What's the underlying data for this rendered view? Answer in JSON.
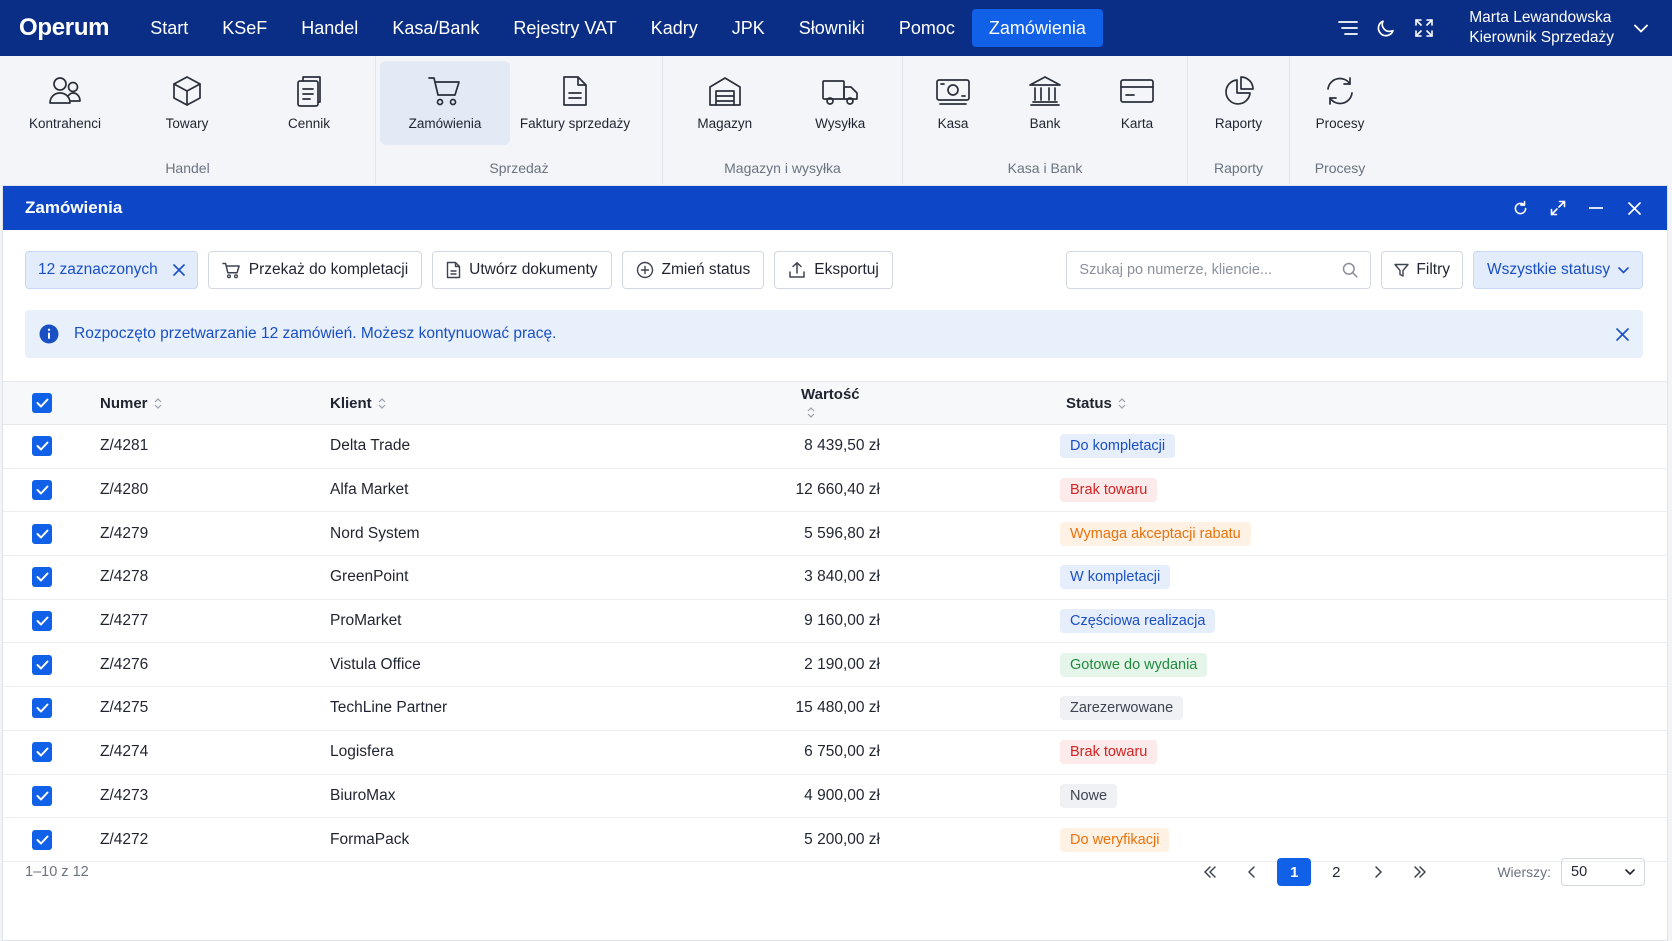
{
  "app": {
    "logo": "Operum"
  },
  "menu": [
    {
      "label": "Start"
    },
    {
      "label": "KSeF"
    },
    {
      "label": "Handel"
    },
    {
      "label": "Kasa/Bank"
    },
    {
      "label": "Rejestry VAT"
    },
    {
      "label": "Kadry"
    },
    {
      "label": "JPK"
    },
    {
      "label": "Słowniki"
    },
    {
      "label": "Pomoc"
    },
    {
      "label": "Zamówienia",
      "active": true
    }
  ],
  "user": {
    "name": "Marta Lewandowska",
    "role": "Kierownik Sprzedaży"
  },
  "ribbon": {
    "groups": [
      {
        "label": "Handel",
        "items": [
          {
            "label": "Kontrahenci",
            "icon": "users-icon"
          },
          {
            "label": "Towary",
            "icon": "box-icon"
          },
          {
            "label": "Cennik",
            "icon": "price-list-icon"
          }
        ]
      },
      {
        "label": "Sprzedaż",
        "items": [
          {
            "label": "Zamówienia",
            "icon": "cart-icon",
            "active": true
          },
          {
            "label": "Faktury sprzedaży",
            "icon": "document-icon"
          }
        ]
      },
      {
        "label": "Magazyn i wysyłka",
        "items": [
          {
            "label": "Magazyn",
            "icon": "warehouse-icon"
          },
          {
            "label": "Wysyłka",
            "icon": "truck-icon"
          }
        ]
      },
      {
        "label": "Kasa i Bank",
        "items": [
          {
            "label": "Kasa",
            "icon": "cash-icon"
          },
          {
            "label": "Bank",
            "icon": "bank-icon"
          },
          {
            "label": "Karta",
            "icon": "card-icon"
          }
        ]
      },
      {
        "label": "Raporty",
        "items": [
          {
            "label": "Raporty",
            "icon": "pie-chart-icon"
          }
        ]
      },
      {
        "label": "Procesy",
        "items": [
          {
            "label": "Procesy",
            "icon": "refresh-icon"
          }
        ]
      }
    ]
  },
  "window": {
    "title": "Zamówienia"
  },
  "toolbar": {
    "selected": "12 zaznaczonych",
    "handover": "Przekaż do kompletacji",
    "create_docs": "Utwórz dokumenty",
    "change_status": "Zmień status",
    "export": "Eksportuj",
    "search_placeholder": "Szukaj po numerze, kliencie...",
    "filters": "Filtry",
    "status_filter": "Wszystkie statusy"
  },
  "info": {
    "message": "Rozpoczęto przetwarzanie 12 zamówień. Możesz kontynuować pracę."
  },
  "table": {
    "headers": {
      "number": "Numer",
      "client": "Klient",
      "value": "Wartość",
      "status": "Status"
    },
    "rows": [
      {
        "number": "Z/4281",
        "client": "Delta Trade",
        "value": "8 439,50 zł",
        "status": "Do kompletacji",
        "tone": "blue"
      },
      {
        "number": "Z/4280",
        "client": "Alfa Market",
        "value": "12 660,40 zł",
        "status": "Brak towaru",
        "tone": "red"
      },
      {
        "number": "Z/4279",
        "client": "Nord System",
        "value": "5 596,80 zł",
        "status": "Wymaga akceptacji rabatu",
        "tone": "orange"
      },
      {
        "number": "Z/4278",
        "client": "GreenPoint",
        "value": "3 840,00 zł",
        "status": "W kompletacji",
        "tone": "blue"
      },
      {
        "number": "Z/4277",
        "client": "ProMarket",
        "value": "9 160,00 zł",
        "status": "Częściowa realizacja",
        "tone": "blue"
      },
      {
        "number": "Z/4276",
        "client": "Vistula Office",
        "value": "2 190,00 zł",
        "status": "Gotowe do wydania",
        "tone": "green"
      },
      {
        "number": "Z/4275",
        "client": "TechLine Partner",
        "value": "15 480,00 zł",
        "status": "Zarezerwowane",
        "tone": "gray"
      },
      {
        "number": "Z/4274",
        "client": "Logisfera",
        "value": "6 750,00 zł",
        "status": "Brak towaru",
        "tone": "red"
      },
      {
        "number": "Z/4273",
        "client": "BiuroMax",
        "value": "4 900,00 zł",
        "status": "Nowe",
        "tone": "gray"
      },
      {
        "number": "Z/4272",
        "client": "FormaPack",
        "value": "5 200,00 zł",
        "status": "Do weryfikacji",
        "tone": "orange"
      }
    ]
  },
  "pager": {
    "range": "1–10 z 12",
    "pages": [
      "1",
      "2"
    ],
    "current": "1",
    "rows_label": "Wierszy:",
    "rows_value": "50"
  },
  "colors": {
    "topbar": "#0a2e86",
    "accent": "#1060e8",
    "window_title": "#0d47c8",
    "tones": {
      "blue": {
        "bg": "#e6eefc",
        "fg": "#1a4fc4"
      },
      "red": {
        "bg": "#fdeaea",
        "fg": "#d32222"
      },
      "orange": {
        "bg": "#fff1e4",
        "fg": "#e8720c"
      },
      "green": {
        "bg": "#e5f5ea",
        "fg": "#1f8a3c"
      },
      "gray": {
        "bg": "#f0f1f4",
        "fg": "#3d4350"
      }
    }
  }
}
